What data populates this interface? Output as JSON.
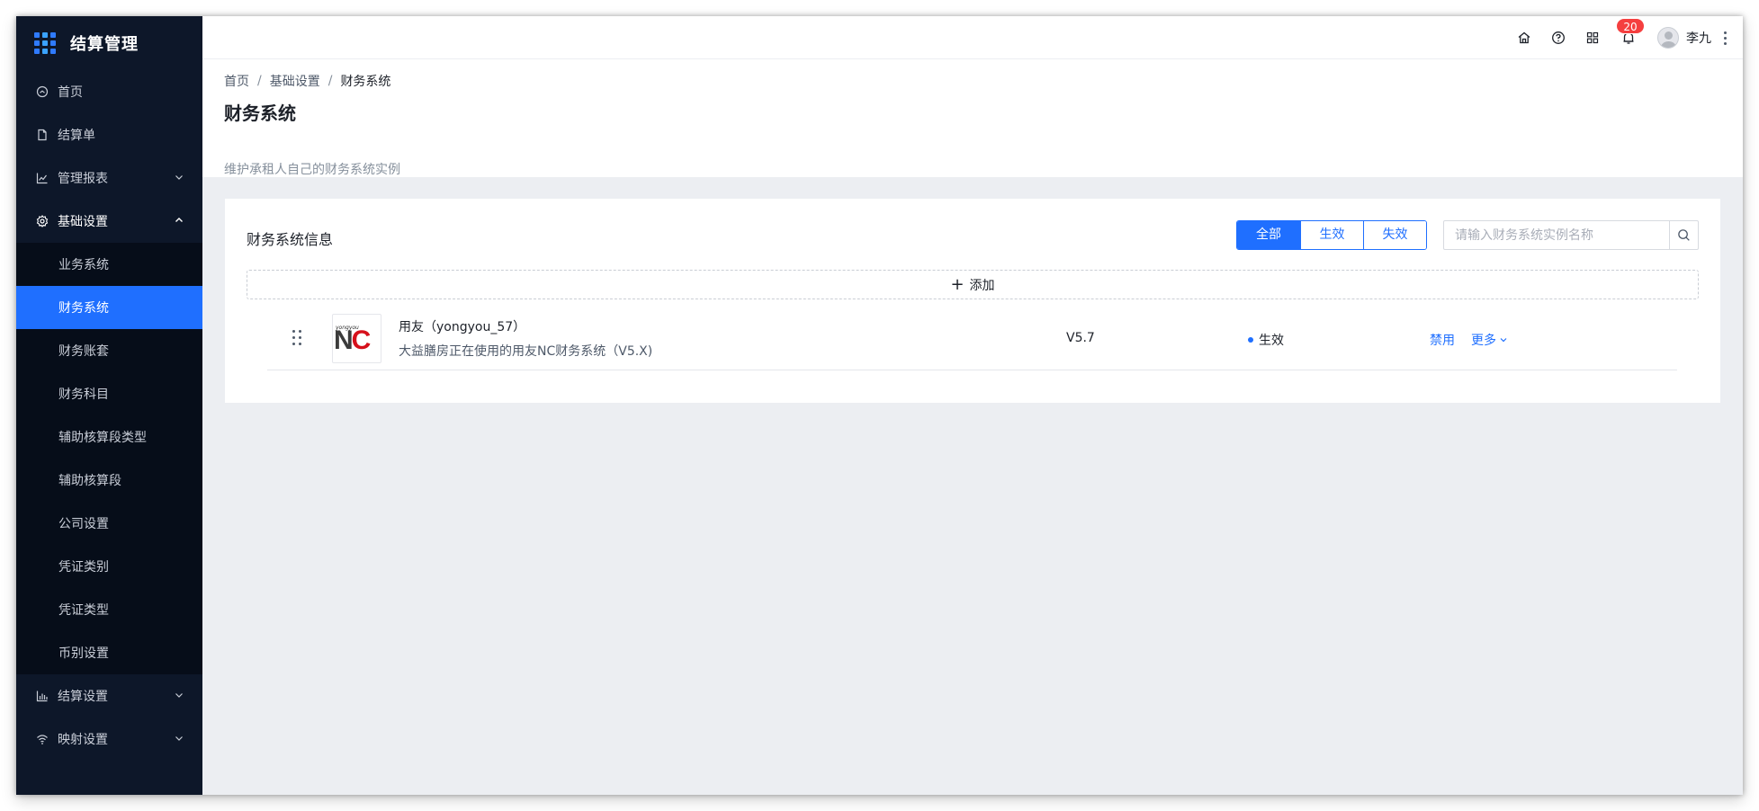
{
  "app": {
    "title": "结算管理"
  },
  "sidebar": {
    "items": [
      {
        "label": "首页",
        "icon": "dashboard-icon"
      },
      {
        "label": "结算单",
        "icon": "file-icon"
      },
      {
        "label": "管理报表",
        "icon": "line-chart-icon"
      },
      {
        "label": "基础设置",
        "icon": "gear-icon"
      },
      {
        "label": "结算设置",
        "icon": "bar-chart-icon"
      },
      {
        "label": "映射设置",
        "icon": "wifi-icon"
      }
    ],
    "submenu": [
      {
        "label": "业务系统"
      },
      {
        "label": "财务系统"
      },
      {
        "label": "财务账套"
      },
      {
        "label": "财务科目"
      },
      {
        "label": "辅助核算段类型"
      },
      {
        "label": "辅助核算段"
      },
      {
        "label": "公司设置"
      },
      {
        "label": "凭证类别"
      },
      {
        "label": "凭证类型"
      },
      {
        "label": "币别设置"
      }
    ]
  },
  "topbar": {
    "notification_count": "20",
    "user_name": "李九"
  },
  "breadcrumb": [
    "首页",
    "基础设置",
    "财务系统"
  ],
  "page": {
    "title": "财务系统",
    "description": "维护承租人自己的财务系统实例"
  },
  "card": {
    "title": "财务系统信息",
    "filters": [
      "全部",
      "生效",
      "失效"
    ],
    "active_filter": "全部",
    "search_placeholder": "请输入财务系统实例名称",
    "add_label": "添加"
  },
  "rows": [
    {
      "logo_small": "yongyou",
      "logo_n": "N",
      "logo_c": "C",
      "name": "用友（yongyou_57）",
      "description": "大益膳房正在使用的用友NC财务系统（V5.X)",
      "version": "V5.7",
      "status": "生效",
      "action_disable": "禁用",
      "action_more": "更多"
    }
  ],
  "colors": {
    "primary": "#1f6fff",
    "sidebar_bg": "#0d1729",
    "badge": "#f53f3f",
    "logo_red": "#d6101b"
  }
}
